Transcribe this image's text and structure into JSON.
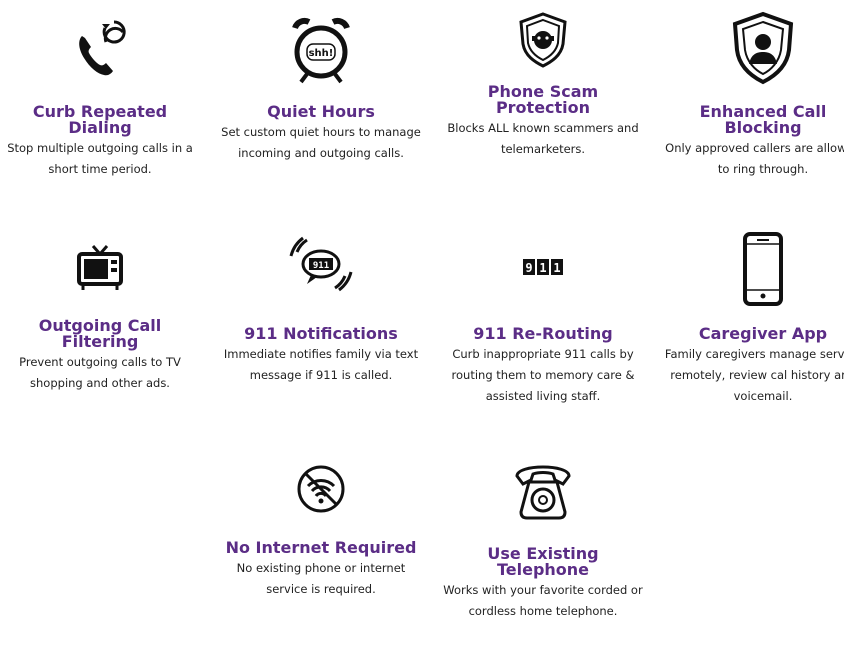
{
  "features": [
    {
      "icon": "phone-repeat-icon",
      "title": "Curb Repeated Dialing",
      "description": "Stop multiple outgoing calls in a short time period."
    },
    {
      "icon": "alarm-clock-shh-icon",
      "icon_text": "shh!",
      "title": "Quiet Hours",
      "description": "Set custom quiet hours to manage incoming and outgoing calls."
    },
    {
      "icon": "shield-bandit-icon",
      "title": "Phone Scam Protection",
      "description": "Blocks ALL known scammers and telemarketers."
    },
    {
      "icon": "shield-user-icon",
      "title": "Enhanced Call Blocking",
      "description": "Only approved callers are allowed to ring through."
    },
    {
      "icon": "tv-icon",
      "title": "Outgoing Call Filtering",
      "description": "Prevent outgoing calls to TV shopping and other ads."
    },
    {
      "icon": "911-bubble-icon",
      "icon_text": "911",
      "title": "911 Notifications",
      "description": "Immediate notifies family via text message if 911 is called."
    },
    {
      "icon": "911-digits-icon",
      "icon_text": "911",
      "title": "911 Re-Routing",
      "description": "Curb inappropriate 911 calls by routing them to memory care & assisted living staff."
    },
    {
      "icon": "smartphone-icon",
      "title": "Caregiver App",
      "description": "Family caregivers manage service remotely, review cal history and voicemail."
    },
    {
      "icon": "no-wifi-icon",
      "title": "No Internet Required",
      "description": "No existing phone or internet service is required."
    },
    {
      "icon": "rotary-telephone-icon",
      "title": "Use Existing Telephone",
      "description": "Works with your favorite corded or cordless home telephone."
    }
  ],
  "colors": {
    "title": "#5b2d86",
    "text": "#222222",
    "icon": "#111111"
  }
}
